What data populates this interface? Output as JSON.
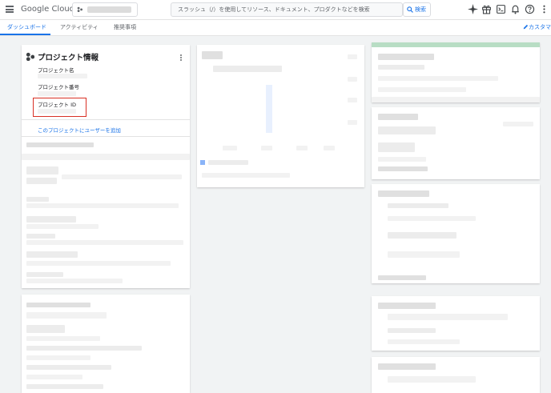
{
  "header": {
    "logo_text": "Google Cloud",
    "search_placeholder": "スラッシュ（/）を使用してリソース、ドキュメント、プロダクトなどを検索",
    "search_button_label": "検索"
  },
  "tabs": [
    {
      "label": "ダッシュボード",
      "active": true
    },
    {
      "label": "アクティビティ",
      "active": false
    },
    {
      "label": "推奨事項",
      "active": false
    }
  ],
  "customize_label": "カスタマ",
  "project_card": {
    "title": "プロジェクト情報",
    "fields": [
      {
        "label": "プロジェクト名"
      },
      {
        "label": "プロジェクト番号"
      },
      {
        "label": "プロジェクト ID"
      }
    ],
    "add_user_link": "このプロジェクトにユーザーを追加"
  },
  "colors": {
    "accent": "#1a73e8",
    "highlight": "#d93025",
    "green_strip": "#b8ddc4"
  }
}
